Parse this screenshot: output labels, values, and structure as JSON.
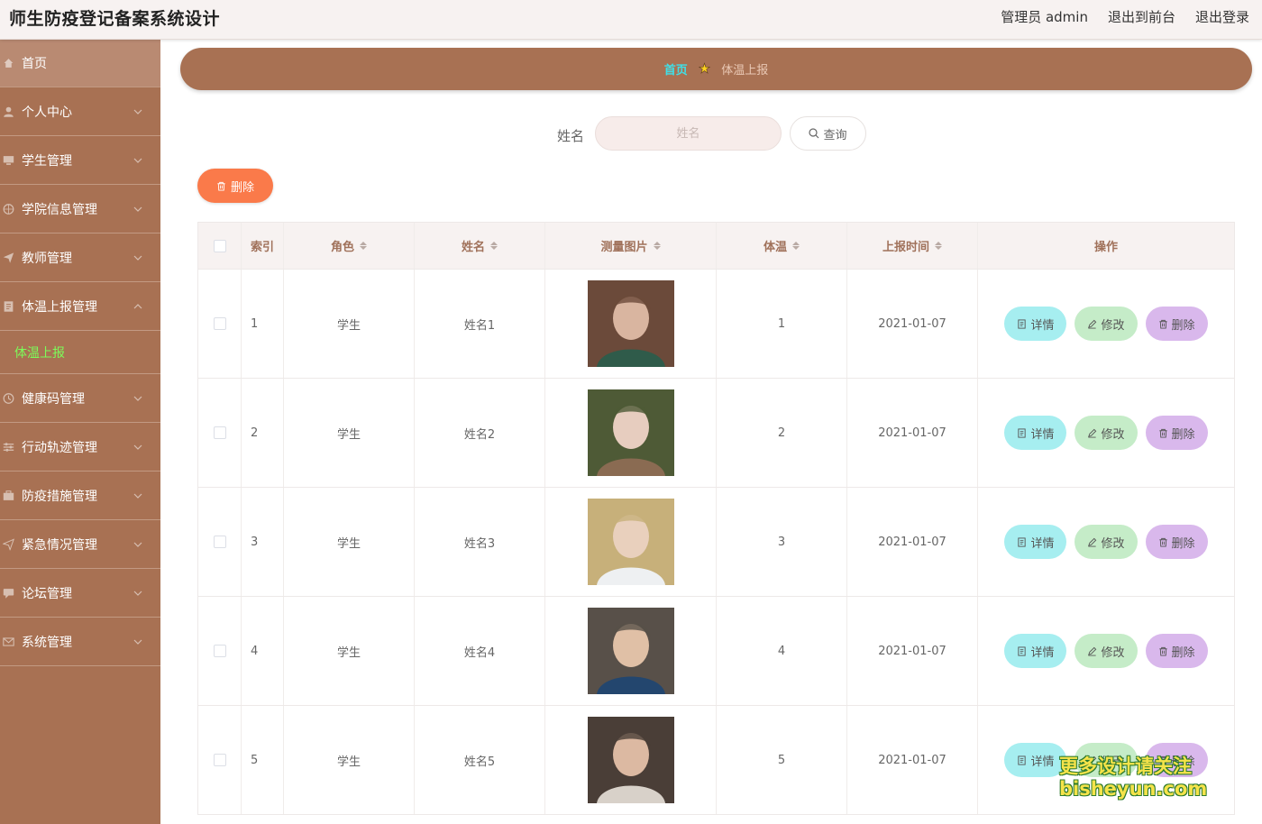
{
  "header": {
    "title": "师生防疫登记备案系统设计",
    "admin_label": "管理员 admin",
    "to_front_label": "退出到前台",
    "logout_label": "退出登录"
  },
  "sidebar": {
    "items": [
      {
        "label": "首页",
        "icon": "home-icon"
      },
      {
        "label": "个人中心",
        "icon": "user-icon"
      },
      {
        "label": "学生管理",
        "icon": "monitor-icon"
      },
      {
        "label": "学院信息管理",
        "icon": "globe-icon"
      },
      {
        "label": "教师管理",
        "icon": "send-icon"
      },
      {
        "label": "体温上报管理",
        "icon": "document-icon",
        "expanded": true,
        "children": [
          {
            "label": "体温上报"
          }
        ]
      },
      {
        "label": "健康码管理",
        "icon": "clock-icon"
      },
      {
        "label": "行动轨迹管理",
        "icon": "sliders-icon"
      },
      {
        "label": "防疫措施管理",
        "icon": "briefcase-icon"
      },
      {
        "label": "紧急情况管理",
        "icon": "paper-plane-icon"
      },
      {
        "label": "论坛管理",
        "icon": "chat-icon"
      },
      {
        "label": "系统管理",
        "icon": "mail-icon"
      }
    ]
  },
  "breadcrumb": {
    "home": "首页",
    "current": "体温上报"
  },
  "search": {
    "label": "姓名",
    "placeholder": "姓名",
    "query_label": "查询"
  },
  "bulk_delete_label": "删除",
  "table": {
    "columns": [
      "索引",
      "角色",
      "姓名",
      "测量图片",
      "体温",
      "上报时间",
      "操作"
    ],
    "rows": [
      {
        "index": "1",
        "role": "学生",
        "name": "姓名1",
        "temp": "1",
        "time": "2021-01-07"
      },
      {
        "index": "2",
        "role": "学生",
        "name": "姓名2",
        "temp": "2",
        "time": "2021-01-07"
      },
      {
        "index": "3",
        "role": "学生",
        "name": "姓名3",
        "temp": "3",
        "time": "2021-01-07"
      },
      {
        "index": "4",
        "role": "学生",
        "name": "姓名4",
        "temp": "4",
        "time": "2021-01-07"
      },
      {
        "index": "5",
        "role": "学生",
        "name": "姓名5",
        "temp": "5",
        "time": "2021-01-07"
      }
    ],
    "actions": {
      "detail": "详情",
      "edit": "修改",
      "delete": "删除"
    }
  },
  "watermark": {
    "line1": "更多设计请关注",
    "line2": "bisheyun.com"
  }
}
